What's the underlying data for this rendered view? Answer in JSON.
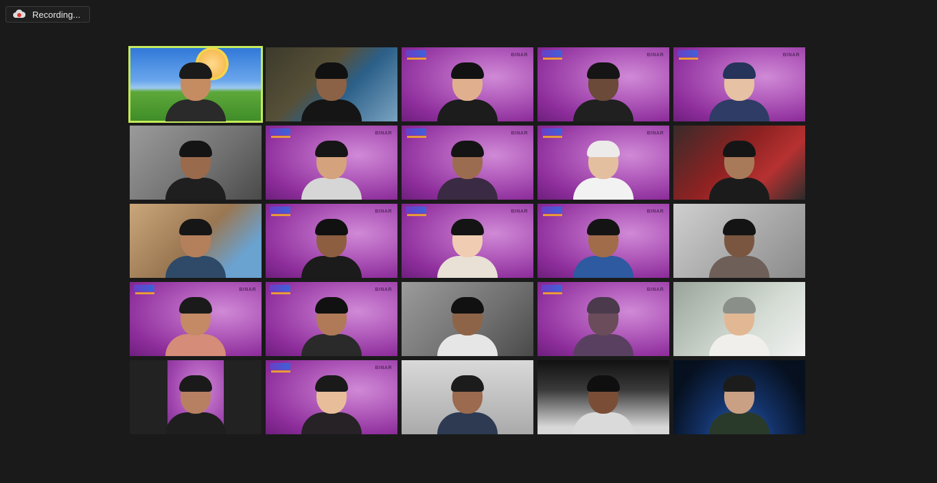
{
  "recording": {
    "label": "Recording...",
    "icon": "cloud-record-icon"
  },
  "gallery": {
    "tiles": [
      {
        "id": 1,
        "background": "xp",
        "active": true,
        "skin": "#c58c62",
        "hair": "#1a1a1a",
        "shirt": "#2a2a2a"
      },
      {
        "id": 2,
        "background": "room",
        "skin": "#8b6246",
        "hair": "#111111",
        "shirt": "#151515"
      },
      {
        "id": 3,
        "background": "binar",
        "logo": "BINAR",
        "skin": "#e0b08e",
        "hair": "#121212",
        "shirt": "#1c1c1c"
      },
      {
        "id": 4,
        "background": "binar",
        "logo": "BINAR",
        "skin": "#6b4a3a",
        "hair": "#151515",
        "shirt": "#202020"
      },
      {
        "id": 5,
        "background": "binar",
        "logo": "BINAR",
        "skin": "#e6c1a3",
        "hair": "#26335a",
        "shirt": "#2f3c66"
      },
      {
        "id": 6,
        "background": "wall",
        "skin": "#9a6a4c",
        "hair": "#141414",
        "shirt": "#1f1f1f"
      },
      {
        "id": 7,
        "background": "binar",
        "logo": "BINAR",
        "skin": "#d4a27c",
        "hair": "#161616",
        "shirt": "#d6d6d6"
      },
      {
        "id": 8,
        "background": "binar",
        "logo": "BINAR",
        "skin": "#9c6c50",
        "hair": "#141414",
        "shirt": "#3b2a44"
      },
      {
        "id": 9,
        "background": "binar",
        "logo": "BINAR",
        "skin": "#e3bfa0",
        "hair": "#ecebea",
        "shirt": "#f2f2f2"
      },
      {
        "id": 10,
        "background": "red",
        "skin": "#a87a5a",
        "hair": "#151515",
        "shirt": "#1b1b1b"
      },
      {
        "id": 11,
        "background": "warm",
        "skin": "#b4805c",
        "hair": "#161616",
        "shirt": "#2f4a68"
      },
      {
        "id": 12,
        "background": "binar",
        "logo": "BINAR",
        "skin": "#8d5e40",
        "hair": "#111111",
        "shirt": "#1b1b1b"
      },
      {
        "id": 13,
        "background": "binar",
        "logo": "BINAR",
        "skin": "#f0cdb2",
        "hair": "#141414",
        "shirt": "#e9e0d6"
      },
      {
        "id": 14,
        "background": "binar",
        "logo": "BINAR",
        "skin": "#a16c4a",
        "hair": "#141414",
        "shirt": "#2d5aa0"
      },
      {
        "id": 15,
        "background": "gray",
        "skin": "#7a5640",
        "hair": "#141414",
        "shirt": "#6e5f58"
      },
      {
        "id": 16,
        "background": "binar",
        "logo": "BINAR",
        "skin": "#c48a66",
        "hair": "#1a1a1a",
        "shirt": "#d58c78"
      },
      {
        "id": 17,
        "background": "binar",
        "logo": "BINAR",
        "skin": "#b07a58",
        "hair": "#111111",
        "shirt": "#2a2a2a"
      },
      {
        "id": 18,
        "background": "wall",
        "skin": "#8e6448",
        "hair": "#111111",
        "shirt": "#e6e6e6"
      },
      {
        "id": 19,
        "background": "binar",
        "logo": "BINAR",
        "skin": "#6a4c5a",
        "hair": "#4a3a4c",
        "shirt": "#5a4060"
      },
      {
        "id": 20,
        "background": "mint",
        "skin": "#e2b894",
        "hair": "#8a8f8a",
        "shirt": "#f0efec"
      },
      {
        "id": 21,
        "background": "portrait",
        "skin": "#b88062",
        "hair": "#1a1a1a",
        "shirt": "#1e1e1e"
      },
      {
        "id": 22,
        "background": "binar",
        "logo": "BINAR",
        "skin": "#e8be9a",
        "hair": "#1a1a1a",
        "shirt": "#262226"
      },
      {
        "id": 23,
        "background": "light",
        "skin": "#9c6a4e",
        "hair": "#1c1c1c",
        "shirt": "#2d3a52"
      },
      {
        "id": 24,
        "background": "dark-studio",
        "skin": "#7a4e36",
        "hair": "#0f0f0f",
        "shirt": "#dadada"
      },
      {
        "id": 25,
        "background": "space",
        "skin": "#caa085",
        "hair": "#1c1c1c",
        "shirt": "#2a3a2a"
      }
    ]
  }
}
